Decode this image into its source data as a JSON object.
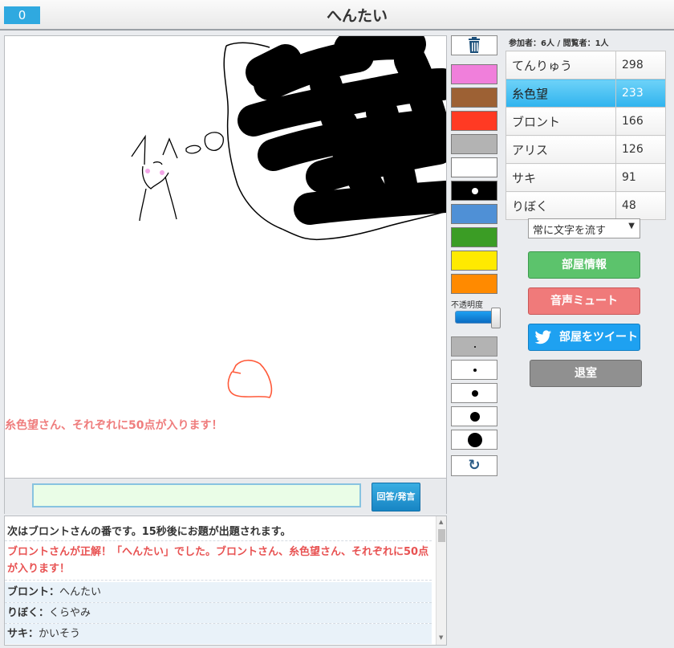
{
  "header": {
    "counter": "0",
    "title": "へんたい"
  },
  "canvas": {
    "notice": "糸色望さん、それぞれに50点が入ります！"
  },
  "answer": {
    "value": "",
    "submit_label": "回答/発言"
  },
  "chat": {
    "messages": [
      {
        "text": "次はブロントさんの番です。15秒後にお題が出題されます。",
        "color": "#333333"
      },
      {
        "text": "ブロントさんが正解！「へんたい」でした。ブロントさん、糸色望さん、それぞれに50点が入ります！",
        "color": "#e85252"
      },
      {
        "name": "ブロント：",
        "text": "へんたい"
      },
      {
        "name": "りぼく：",
        "text": "くらやみ"
      },
      {
        "name": "サキ：",
        "text": "かいそう"
      }
    ]
  },
  "palette": {
    "colors": [
      "#f07fdb",
      "#9d6134",
      "#ff3a23",
      "#b3b3b3",
      "#ffffff",
      "#000000",
      "#4f90d6",
      "#3b9d25",
      "#ffea00",
      "#ff8a00"
    ],
    "opacity_label": "不透明度",
    "opacity_value": 1.0,
    "trash_icon": "trash-icon",
    "undo_icon": "undo-icon"
  },
  "room": {
    "participants": "参加者：6人 / 閲覧者：1人",
    "players": [
      {
        "name": "てんりゅう",
        "score": "298"
      },
      {
        "name": "糸色望",
        "score": "233",
        "highlight": true
      },
      {
        "name": "ブロント",
        "score": "166"
      },
      {
        "name": "アリス",
        "score": "126"
      },
      {
        "name": "サキ",
        "score": "91"
      },
      {
        "name": "りぼく",
        "score": "48"
      }
    ],
    "select_value": "常に文字を流す",
    "buttons": {
      "info": "部屋情報",
      "mute": "音声ミュート",
      "tweet": "部屋をツイート",
      "exit": "退室"
    },
    "colors": {
      "info": "#5cc36c",
      "mute": "#f07a7a",
      "tweet": "#1ea1f1",
      "exit": "#909090"
    }
  }
}
